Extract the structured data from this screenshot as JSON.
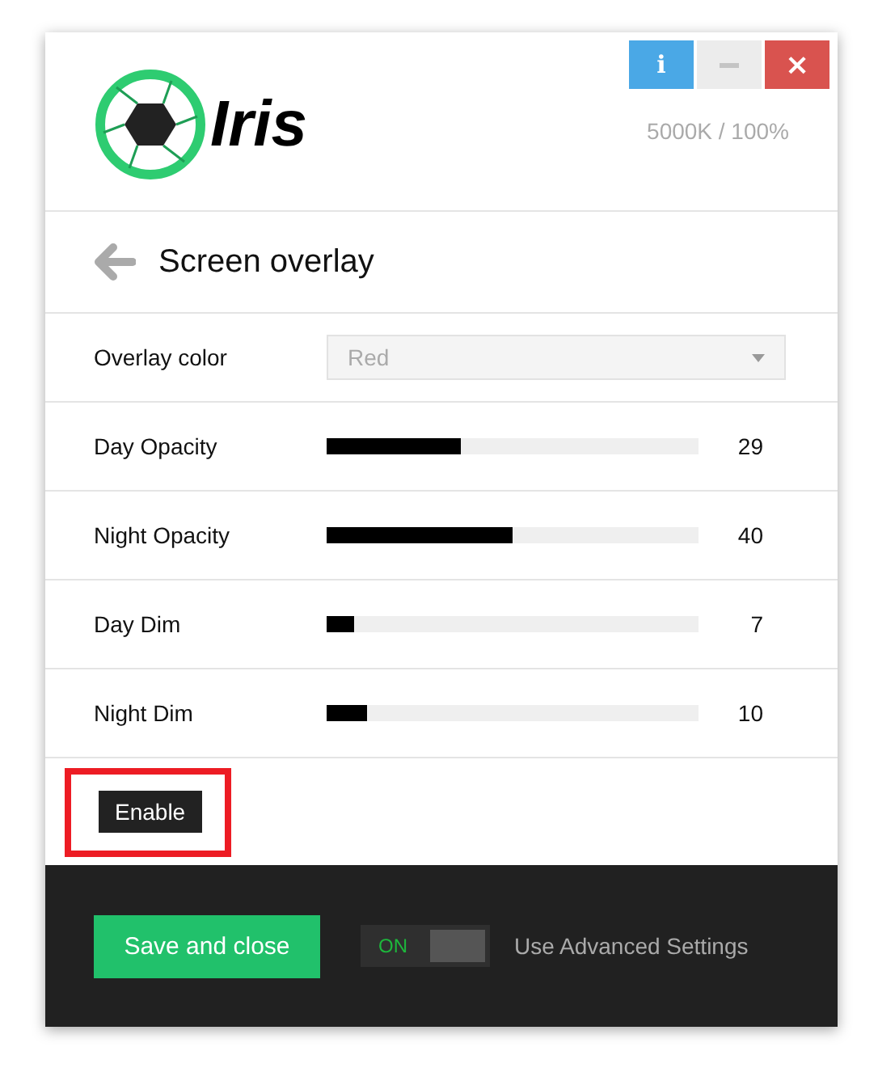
{
  "window": {
    "app_name": "Iris",
    "status": "5000K / 100%",
    "buttons": [
      {
        "kind": "info",
        "label": "i"
      },
      {
        "kind": "minimize"
      },
      {
        "kind": "close",
        "label": "×"
      }
    ]
  },
  "page": {
    "title": "Screen overlay"
  },
  "settings": [
    {
      "kind": "dropdown",
      "label": "Overlay color",
      "value": "Red",
      "disabled": true
    },
    {
      "kind": "slider",
      "label": "Day Opacity",
      "level": 0.36,
      "reading": "29"
    },
    {
      "kind": "slider",
      "label": "Night Opacity",
      "level": 0.5,
      "reading": "40"
    },
    {
      "kind": "slider",
      "label": "Day Dim",
      "level": 0.074,
      "reading": "7"
    },
    {
      "kind": "slider",
      "label": "Night Dim",
      "level": 0.11,
      "reading": "10"
    }
  ],
  "enable_button": {
    "label": "Enable",
    "highlighted": true
  },
  "footer": {
    "save_button": "Save and close",
    "toggle": {
      "label": "ON",
      "on": true
    },
    "toggle_caption": "Use Advanced Settings"
  }
}
